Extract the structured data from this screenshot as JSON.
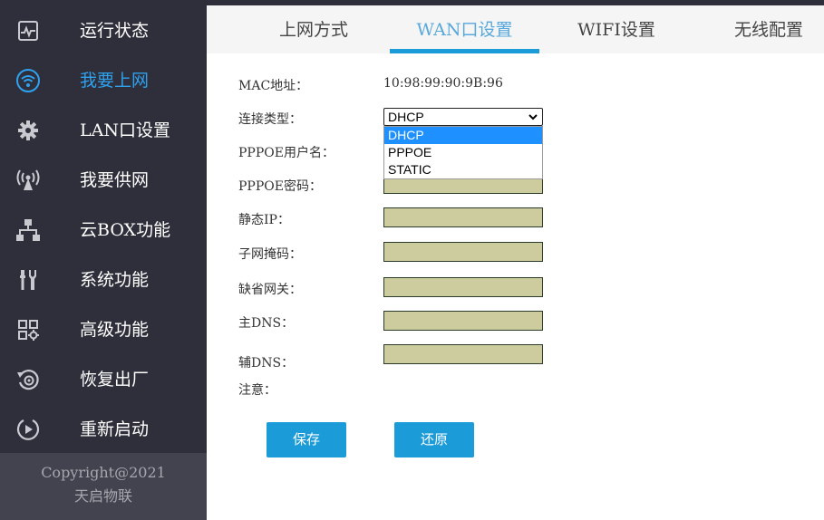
{
  "sidebar": {
    "items": [
      {
        "label": "运行状态",
        "icon": "chart-monitor-icon"
      },
      {
        "label": "我要上网",
        "icon": "wifi-icon"
      },
      {
        "label": "LAN口设置",
        "icon": "gear-icon"
      },
      {
        "label": "我要供网",
        "icon": "antenna-icon"
      },
      {
        "label": "云BOX功能",
        "icon": "network-tree-icon"
      },
      {
        "label": "系统功能",
        "icon": "tools-icon"
      },
      {
        "label": "高级功能",
        "icon": "grid-settings-icon"
      },
      {
        "label": "恢复出厂",
        "icon": "restore-icon"
      },
      {
        "label": "重新启动",
        "icon": "restart-icon"
      }
    ],
    "active_index": 1,
    "footer": {
      "copyright": "Copyright@2021",
      "company": "天启物联"
    }
  },
  "tabs": [
    {
      "label": "上网方式"
    },
    {
      "label": "WAN口设置"
    },
    {
      "label": "WIFI设置"
    },
    {
      "label": "无线配置"
    }
  ],
  "active_tab": 1,
  "form": {
    "mac_label": "MAC地址：",
    "mac_value": "10:98:99:90:9B:96",
    "conn_type_label": "连接类型：",
    "conn_type_value": "DHCP",
    "conn_type_options": [
      "DHCP",
      "PPPOE",
      "STATIC"
    ],
    "pppoe_user_label": "PPPOE用户名：",
    "pppoe_pass_label": "PPPOE密码：",
    "static_ip_label": "静态IP：",
    "subnet_label": "子网掩码：",
    "gateway_label": "缺省网关：",
    "dns1_label": "主DNS：",
    "dns2_label": "辅DNS：",
    "note_label": "注意：",
    "pppoe_user_value": "",
    "pppoe_pass_value": "",
    "static_ip_value": "",
    "subnet_value": "",
    "gateway_value": "",
    "dns1_value": "",
    "dns2_value": ""
  },
  "buttons": {
    "save": "保存",
    "restore": "还原"
  },
  "colors": {
    "sidebar_bg": "#2e2f3a",
    "sidebar_footer_bg": "#42434f",
    "accent": "#1b9bd7",
    "active_text": "#2ea1ef",
    "field_bg": "#cccc9f",
    "option_highlight": "#1e90ff"
  }
}
